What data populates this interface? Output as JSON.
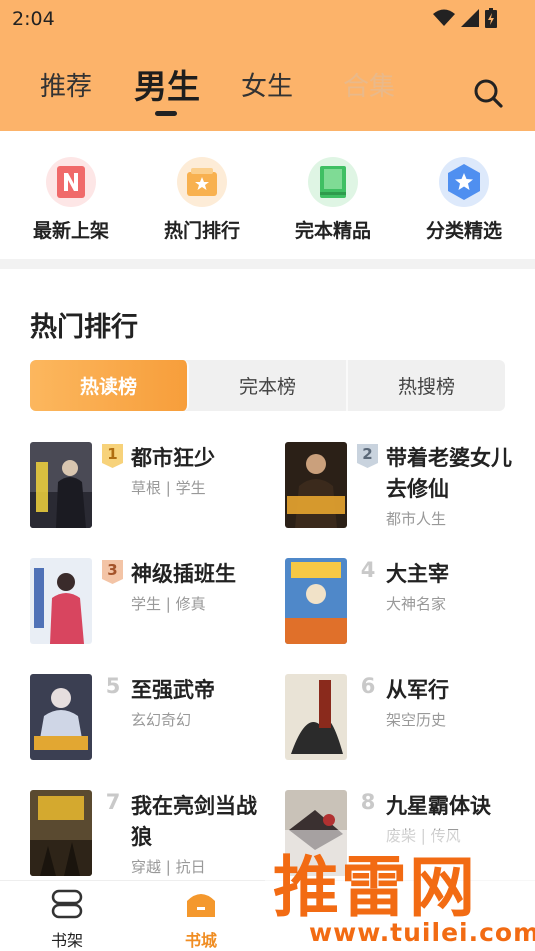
{
  "status_bar": {
    "time": "2:04"
  },
  "nav": {
    "tabs": [
      {
        "label": "推荐"
      },
      {
        "label": "男生"
      },
      {
        "label": "女生"
      },
      {
        "label": "合集"
      }
    ],
    "active_tab": "男生"
  },
  "categories": [
    {
      "label": "最新上架",
      "icon": "new-arrival-icon"
    },
    {
      "label": "热门排行",
      "icon": "hot-rank-icon"
    },
    {
      "label": "完本精品",
      "icon": "finished-book-icon"
    },
    {
      "label": "分类精选",
      "icon": "category-star-icon"
    }
  ],
  "section": {
    "title": "热门排行",
    "tabs": [
      {
        "label": "热读榜"
      },
      {
        "label": "完本榜"
      },
      {
        "label": "热搜榜"
      }
    ],
    "active_tab": "热读榜"
  },
  "books": [
    {
      "rank": "1",
      "title": "都市狂少",
      "meta": "草根 | 学生"
    },
    {
      "rank": "2",
      "title": "带着老婆女儿去修仙",
      "meta": "都市人生"
    },
    {
      "rank": "3",
      "title": "神级插班生",
      "meta": "学生 | 修真"
    },
    {
      "rank": "4",
      "title": "大主宰",
      "meta": "大神名家"
    },
    {
      "rank": "5",
      "title": "至强武帝",
      "meta": "玄幻奇幻"
    },
    {
      "rank": "6",
      "title": "从军行",
      "meta": "架空历史"
    },
    {
      "rank": "7",
      "title": "我在亮剑当战狼",
      "meta": "穿越 | 抗日"
    },
    {
      "rank": "8",
      "title": "九星霸体诀",
      "meta": "废柴 | 传风"
    }
  ],
  "bottom_nav": [
    {
      "label": "书架"
    },
    {
      "label": "书城"
    }
  ],
  "watermark": {
    "big": "推雷网",
    "small": "www.tuilei.com"
  },
  "colors": {
    "header": "#fcb36a",
    "accent": "#f7a03c",
    "active_label": "#f08d22"
  }
}
